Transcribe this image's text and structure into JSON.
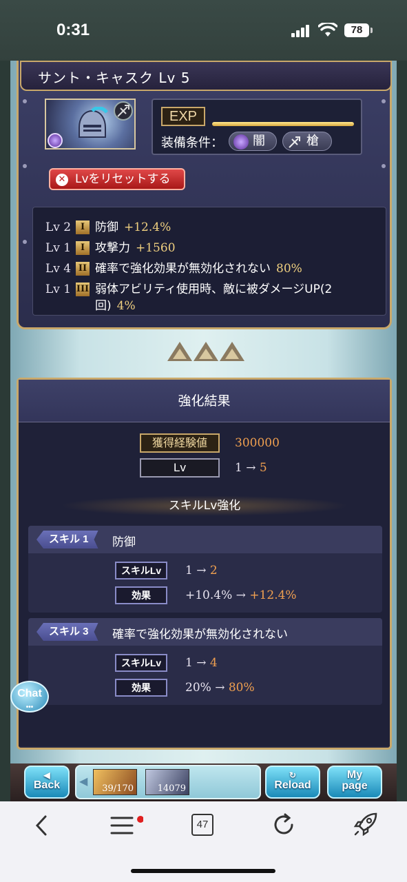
{
  "status": {
    "time": "0:31",
    "battery": "78"
  },
  "weapon": {
    "name": "サント・キャスク Lv 5",
    "exp_label": "EXP",
    "equip_label": "装備条件：",
    "equip_element": "闇",
    "equip_type": "槍",
    "reset_label": "Lvをリセットする",
    "skills": [
      {
        "lv": "Lv 2",
        "slot": "I",
        "name": "防御",
        "value": "+12.4%"
      },
      {
        "lv": "Lv 1",
        "slot": "I",
        "name": "攻撃力",
        "value": "+1560"
      },
      {
        "lv": "Lv 4",
        "slot": "II",
        "name": "確率で強化効果が無効化されない",
        "value": "80%"
      },
      {
        "lv": "Lv 1",
        "slot": "III",
        "name": "弱体アビリティ使用時、敵に被ダメージUP(2",
        "name2": "回)",
        "value": "4%"
      }
    ]
  },
  "result": {
    "title": "強化結果",
    "exp_gain_label": "獲得経験値",
    "exp_gain_value": "300000",
    "lv_label": "Lv",
    "lv_from": "1 →",
    "lv_to": "5",
    "skill_up_title": "スキルLv強化",
    "cards": [
      {
        "tag": "スキル 1",
        "name": "防御",
        "lv_chip": "スキルLv",
        "lv_from": "1 →",
        "lv_to": "2",
        "eff_chip": "効果",
        "eff_from": "+10.4% →",
        "eff_to": "+12.4%"
      },
      {
        "tag": "スキル 3",
        "name": "確率で強化効果が無効化されない",
        "lv_chip": "スキルLv",
        "lv_from": "1 →",
        "lv_to": "4",
        "eff_chip": "効果",
        "eff_from": "20% →",
        "eff_to": "80%"
      }
    ]
  },
  "chat": {
    "label": "Chat",
    "dots": "•••"
  },
  "nav": {
    "back": [
      "Back"
    ],
    "reload": "Reload",
    "mypage": [
      "My",
      "page"
    ],
    "stamina": "39/170",
    "bp": "14079"
  },
  "browser": {
    "tabs_count": "47"
  }
}
